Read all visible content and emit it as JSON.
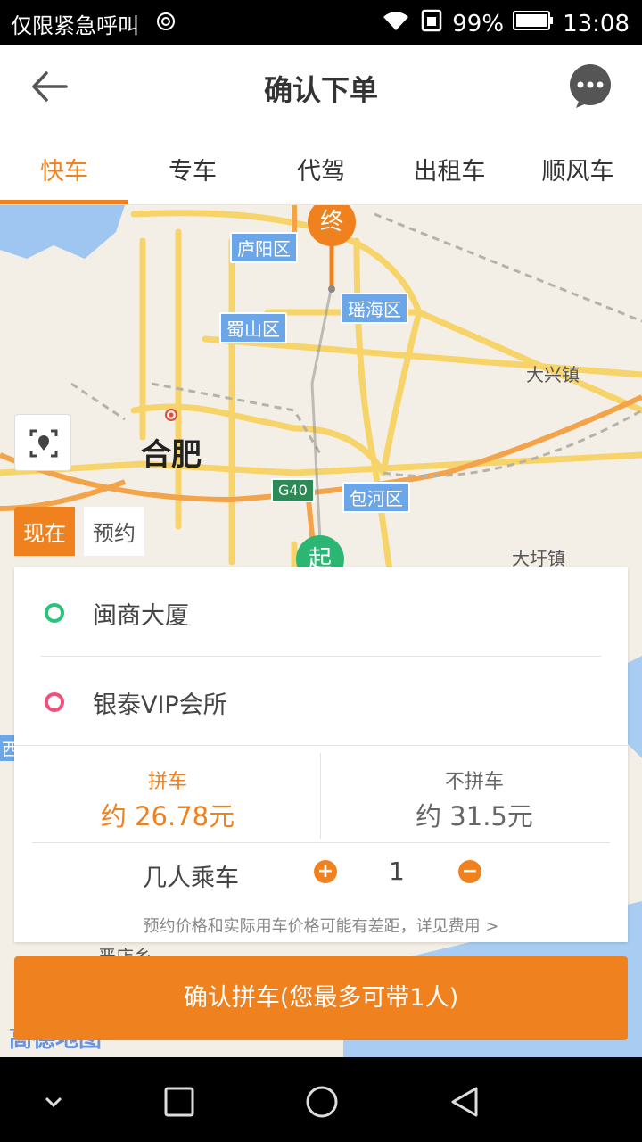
{
  "status_bar": {
    "carrier": "仅限紧急呼叫",
    "battery": "99%",
    "time": "13:08",
    "icons": [
      "nfc-icon",
      "wifi-icon",
      "sim-icon",
      "battery-icon"
    ]
  },
  "header": {
    "title": "确认下单",
    "back_icon": "arrow-left-icon",
    "chat_icon": "chat-bubble-icon"
  },
  "tabs": [
    {
      "label": "快车",
      "active": true
    },
    {
      "label": "专车",
      "active": false
    },
    {
      "label": "代驾",
      "active": false
    },
    {
      "label": "出租车",
      "active": false
    },
    {
      "label": "顺风车",
      "active": false
    }
  ],
  "map": {
    "city": "合肥",
    "districts": [
      "庐阳区",
      "瑶海区",
      "蜀山区",
      "包河区"
    ],
    "towns": [
      "大兴镇",
      "大圩镇",
      "严店乡"
    ],
    "road_shield": "G40",
    "partial_label": "西",
    "end_pin": "终",
    "start_pin": "起",
    "watermark": "高德地图",
    "colors": {
      "end_pin": "#f0811f",
      "start_pin": "#2bb673",
      "district_label": "#6aa6e8"
    }
  },
  "time_toggle": {
    "now": "现在",
    "book": "预约"
  },
  "order": {
    "origin": "闽商大厦",
    "destination": "银泰VIP会所",
    "origin_color": "#2bc27a",
    "destination_color": "#f0507a",
    "carpool": {
      "label": "拼车",
      "price": "约 26.78元"
    },
    "no_carpool": {
      "label": "不拼车",
      "price": "约 31.5元"
    },
    "passengers": {
      "label": "几人乘车",
      "count": "1",
      "plus": "+",
      "minus": "−"
    },
    "note": "预约价格和实际用车价格可能有差距，详见费用 >"
  },
  "confirm_button": "确认拼车(您最多可带1人)",
  "accent_color": "#f0811f"
}
